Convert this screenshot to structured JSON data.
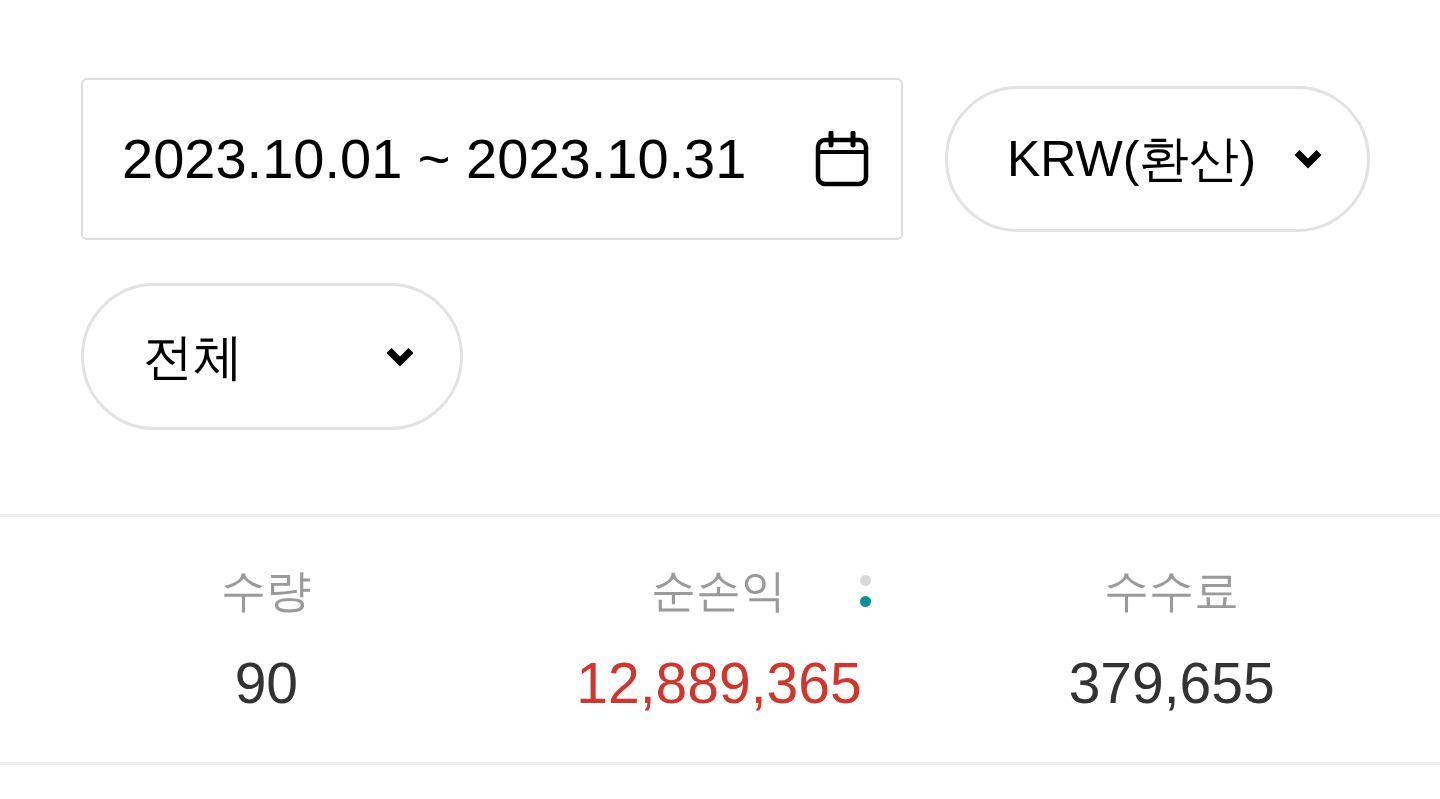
{
  "filters": {
    "date_range": {
      "value": "2023.10.01 ~ 2023.10.31"
    },
    "currency": {
      "value": "KRW(환산)"
    },
    "category": {
      "value": "전체"
    }
  },
  "summary": [
    {
      "label": "수량",
      "value": "90",
      "color": "#333333"
    },
    {
      "label": "순손익",
      "value": "12,889,365",
      "color": "#d1352c",
      "pager": [
        {
          "selected": false
        },
        {
          "selected": true
        }
      ]
    },
    {
      "label": "수수료",
      "value": "379,655",
      "color": "#333333"
    }
  ]
}
